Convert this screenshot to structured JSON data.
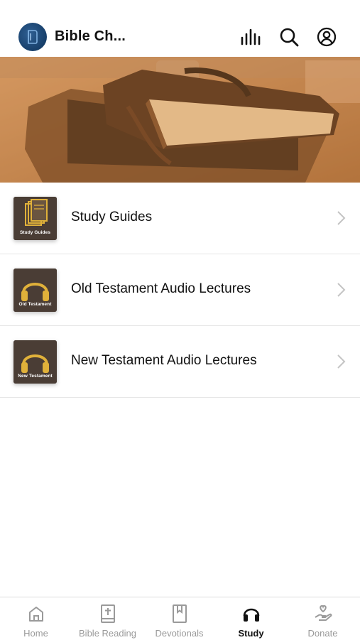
{
  "header": {
    "app_title": "Bible Ch...",
    "icons": [
      "equalizer-icon",
      "search-icon",
      "account-icon"
    ]
  },
  "list": {
    "items": [
      {
        "label": "Study Guides",
        "thumb_caption": "Study Guides",
        "thumb_icon": "stacked-books-icon"
      },
      {
        "label": "Old Testament Audio Lectures",
        "thumb_caption": "Old Testament",
        "thumb_icon": "headphones-icon"
      },
      {
        "label": "New Testament Audio Lectures",
        "thumb_caption": "New Testament",
        "thumb_icon": "headphones-icon"
      }
    ]
  },
  "tabbar": {
    "tabs": [
      {
        "label": "Home",
        "icon": "home-icon",
        "active": false
      },
      {
        "label": "Bible Reading",
        "icon": "bible-icon",
        "active": false
      },
      {
        "label": "Devotionals",
        "icon": "bookmark-book-icon",
        "active": false
      },
      {
        "label": "Study",
        "icon": "headphones-icon",
        "active": true
      },
      {
        "label": "Donate",
        "icon": "donate-hand-icon",
        "active": false
      }
    ]
  },
  "colors": {
    "accent_gold": "#e0b13a",
    "logo_blue": "#1d4670",
    "hero_tint": "#c98a55",
    "tab_inactive": "#9a9a9a",
    "tab_active": "#111111"
  }
}
